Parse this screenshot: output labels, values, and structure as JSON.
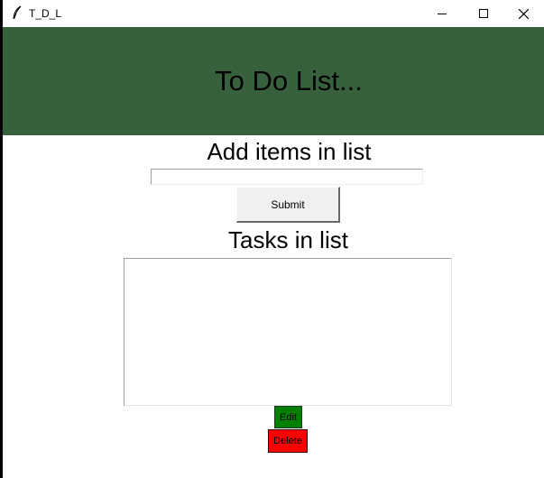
{
  "window": {
    "title": "T_D_L",
    "icon": "feather-icon",
    "controls": [
      "minimize-icon",
      "maximize-icon",
      "close-icon"
    ]
  },
  "header": {
    "title": "To Do List...",
    "background": "#37613d"
  },
  "add_section": {
    "label": "Add items in list",
    "input_value": "",
    "submit_label": "Submit"
  },
  "tasks_section": {
    "label": "Tasks in list",
    "items": []
  },
  "actions": {
    "edit_label": "Edit",
    "edit_color": "#008000",
    "delete_label": "Delete",
    "delete_color": "#ff0000"
  }
}
